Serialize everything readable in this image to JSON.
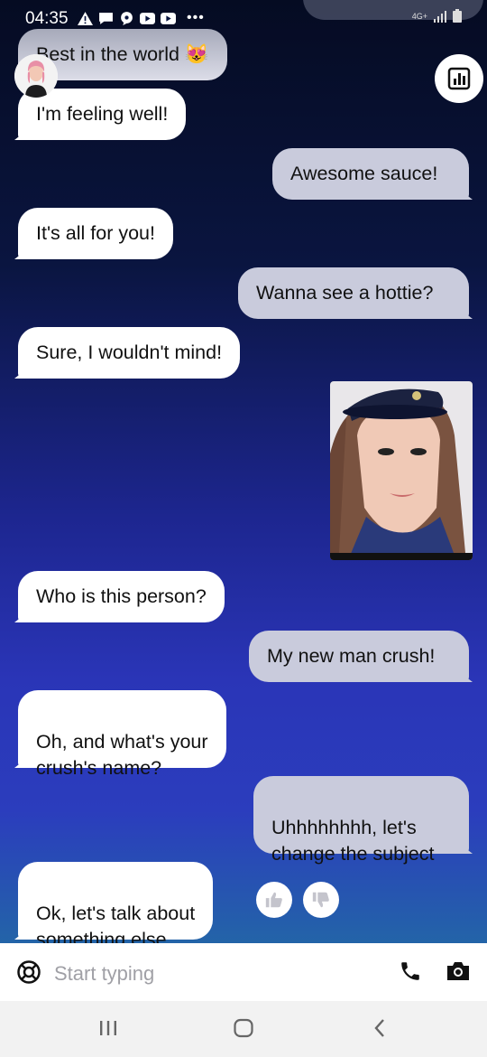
{
  "status_bar": {
    "time": "04:35",
    "network": "4G+"
  },
  "messages": [
    {
      "sender": "bot",
      "text": "Best in the world 😻"
    },
    {
      "sender": "bot",
      "text": "I'm feeling well!"
    },
    {
      "sender": "user",
      "text": "Awesome sauce!"
    },
    {
      "sender": "bot",
      "text": "It's all for you!"
    },
    {
      "sender": "user",
      "text": "Wanna see a hottie?"
    },
    {
      "sender": "bot",
      "text": "Sure, I wouldn't mind!"
    },
    {
      "sender": "bot",
      "text": "Who is this person?"
    },
    {
      "sender": "user",
      "text": "My new man crush!"
    },
    {
      "sender": "bot",
      "text": "Oh, and what's your\ncrush's name?"
    },
    {
      "sender": "user",
      "text": "Uhhhhhhhh, let's\nchange the subject"
    },
    {
      "sender": "bot",
      "text": "Ok, let's talk about\nsomething else."
    }
  ],
  "input": {
    "placeholder": "Start typing"
  },
  "icons": {
    "avatar": "avatar-icon",
    "stats": "bar-chart-icon",
    "thumbs_up": "thumbs-up-icon",
    "thumbs_down": "thumbs-down-icon",
    "help": "lifebuoy-icon",
    "phone": "phone-icon",
    "camera": "camera-icon",
    "nav_recents": "recents-icon",
    "nav_home": "home-icon",
    "nav_back": "back-icon"
  },
  "colors": {
    "bot_bubble": "#ffffff",
    "user_bubble": "#c9cbdc",
    "background_top": "#050b22",
    "background_bottom": "#2364a8"
  }
}
